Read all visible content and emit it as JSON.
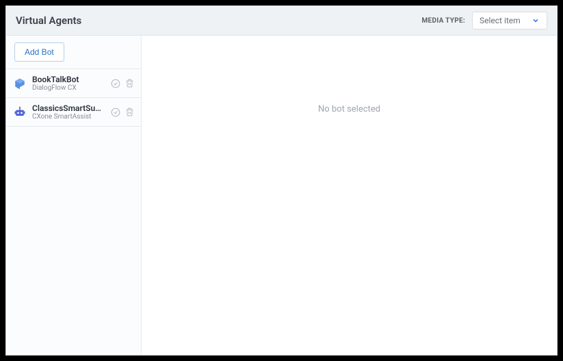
{
  "header": {
    "title": "Virtual Agents",
    "media_type_label": "MEDIA TYPE:",
    "media_select_placeholder": "Select item"
  },
  "sidebar": {
    "add_bot_label": "Add Bot",
    "bots": [
      {
        "name": "BookTalkBot",
        "subtitle": "DialogFlow CX",
        "icon": "dialogflow-icon",
        "icon_color": "#4a7fd6"
      },
      {
        "name": "ClassicsSmartSupport",
        "subtitle": "CXone SmartAssist",
        "icon": "smartassist-icon",
        "icon_color": "#3b5bd6"
      }
    ]
  },
  "main": {
    "empty_message": "No bot selected"
  }
}
